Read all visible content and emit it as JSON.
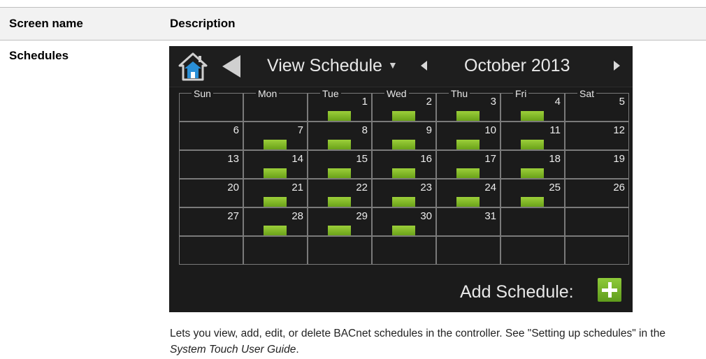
{
  "table": {
    "header": {
      "name_col": "Screen name",
      "desc_col": "Description"
    },
    "row": {
      "name": "Schedules",
      "description_part1": "Lets you view, add, edit, or delete BACnet schedules in the controller. See \"Setting up schedules\" in the ",
      "description_guide": "System Touch User Guide",
      "description_end": "."
    }
  },
  "device": {
    "icons": {
      "home": "home-icon",
      "back": "back-arrow-icon",
      "prev": "prev-month-icon",
      "next": "next-month-icon",
      "add": "plus-icon"
    },
    "view_label": "View Schedule",
    "view_caret": "▼",
    "month_label": "October  2013",
    "weekdays": [
      "Sun",
      "Mon",
      "Tue",
      "Wed",
      "Thu",
      "Fri",
      "Sat"
    ],
    "weeks": [
      [
        {
          "d": ""
        },
        {
          "d": ""
        },
        {
          "d": "1",
          "e": true
        },
        {
          "d": "2",
          "e": true
        },
        {
          "d": "3",
          "e": true
        },
        {
          "d": "4",
          "e": true
        },
        {
          "d": "5"
        }
      ],
      [
        {
          "d": "6"
        },
        {
          "d": "7",
          "e": true
        },
        {
          "d": "8",
          "e": true
        },
        {
          "d": "9",
          "e": true
        },
        {
          "d": "10",
          "e": true
        },
        {
          "d": "11",
          "e": true
        },
        {
          "d": "12"
        }
      ],
      [
        {
          "d": "13"
        },
        {
          "d": "14",
          "e": true
        },
        {
          "d": "15",
          "e": true
        },
        {
          "d": "16",
          "e": true
        },
        {
          "d": "17",
          "e": true
        },
        {
          "d": "18",
          "e": true
        },
        {
          "d": "19"
        }
      ],
      [
        {
          "d": "20"
        },
        {
          "d": "21",
          "e": true
        },
        {
          "d": "22",
          "e": true
        },
        {
          "d": "23",
          "e": true
        },
        {
          "d": "24",
          "e": true
        },
        {
          "d": "25",
          "e": true
        },
        {
          "d": "26"
        }
      ],
      [
        {
          "d": "27"
        },
        {
          "d": "28",
          "e": true
        },
        {
          "d": "29",
          "e": true
        },
        {
          "d": "30",
          "e": true
        },
        {
          "d": "31"
        },
        {
          "d": ""
        },
        {
          "d": ""
        }
      ],
      [
        {
          "d": ""
        },
        {
          "d": ""
        },
        {
          "d": ""
        },
        {
          "d": ""
        },
        {
          "d": ""
        },
        {
          "d": ""
        },
        {
          "d": ""
        }
      ]
    ],
    "add_label": "Add Schedule:",
    "colors": {
      "event_green": "#7cb626",
      "screen_bg": "#1b1b1b",
      "grid_line": "#7a7a7a"
    }
  }
}
